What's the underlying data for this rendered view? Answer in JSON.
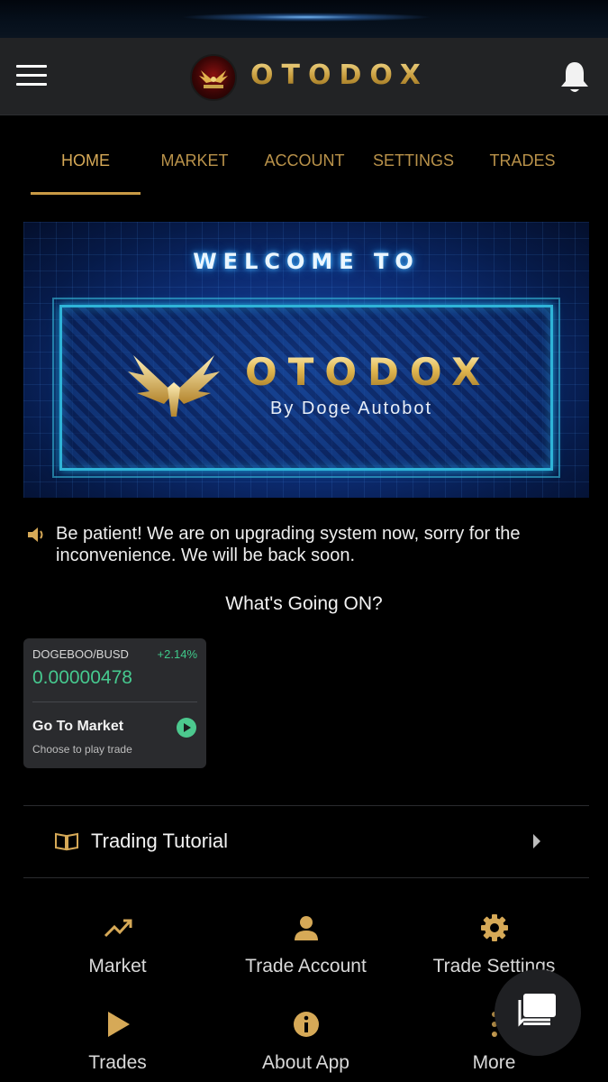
{
  "app": {
    "brand": "OTODOX",
    "logo_caption": "OTODOX"
  },
  "tabs": [
    {
      "label": "HOME",
      "active": true
    },
    {
      "label": "MARKET",
      "active": false
    },
    {
      "label": "ACCOUNT",
      "active": false
    },
    {
      "label": "SETTINGS",
      "active": false
    },
    {
      "label": "TRADES",
      "active": false
    }
  ],
  "banner": {
    "welcome": "WELCOME TO",
    "name": "OTODOX",
    "byline": "By Doge Autobot"
  },
  "notice": {
    "icon": "speaker-icon",
    "message": "Be patient! We are on upgrading system now, sorry for the inconvenience. We will be back soon."
  },
  "section": {
    "title": "What's Going ON?"
  },
  "market_card": {
    "pair": "DOGEBOO/BUSD",
    "change": "+2.14%",
    "price": "0.00000478",
    "action": "Go To Market",
    "subtitle": "Choose to play trade"
  },
  "tutorial": {
    "label": "Trading Tutorial",
    "icon": "book-icon"
  },
  "menu": [
    {
      "label": "Market",
      "icon": "trending-up-icon"
    },
    {
      "label": "Trade Account",
      "icon": "person-icon"
    },
    {
      "label": "Trade Settings",
      "icon": "gear-icon"
    },
    {
      "label": "Trades",
      "icon": "play-icon"
    },
    {
      "label": "About App",
      "icon": "info-icon"
    },
    {
      "label": "More",
      "icon": "more-icon"
    }
  ],
  "colors": {
    "gold": "#c99a45",
    "green": "#46c98f",
    "appbar": "#222325",
    "card": "#2a2b2e"
  }
}
